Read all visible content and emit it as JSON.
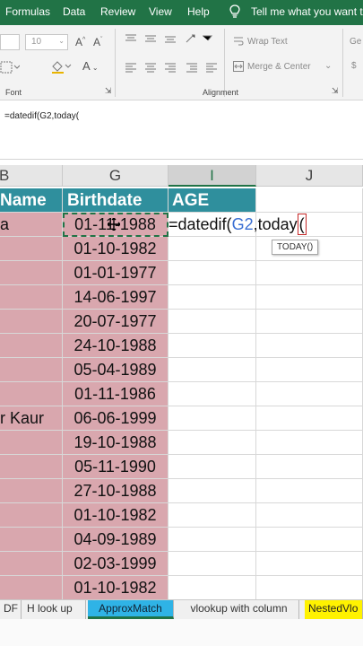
{
  "ribbon": {
    "tabs": [
      "Formulas",
      "Data",
      "Review",
      "View",
      "Help"
    ],
    "tell_me": "Tell me what you want to d",
    "font_size": "10",
    "wrap_text": "Wrap Text",
    "merge_center": "Merge & Center",
    "font_group_label": "Font",
    "alignment_group_label": "Alignment",
    "general_label": "Ge"
  },
  "formula_bar": {
    "text": "=datedif(G2,today("
  },
  "columns": {
    "b": "B",
    "g": "G",
    "i": "I",
    "j": "J"
  },
  "headers": {
    "name": "Name",
    "birthdate": "Birthdate",
    "age": "AGE"
  },
  "rows": [
    {
      "name": "a",
      "birthdate": "01-11-1988"
    },
    {
      "name": "",
      "birthdate": "01-10-1982"
    },
    {
      "name": "",
      "birthdate": "01-01-1977"
    },
    {
      "name": "",
      "birthdate": "14-06-1997"
    },
    {
      "name": "",
      "birthdate": "20-07-1977"
    },
    {
      "name": "",
      "birthdate": "24-10-1988"
    },
    {
      "name": "",
      "birthdate": "05-04-1989"
    },
    {
      "name": "",
      "birthdate": "01-11-1986"
    },
    {
      "name": "r Kaur",
      "birthdate": "06-06-1999"
    },
    {
      "name": "",
      "birthdate": "19-10-1988"
    },
    {
      "name": "",
      "birthdate": "05-11-1990"
    },
    {
      "name": "",
      "birthdate": "27-10-1988"
    },
    {
      "name": "",
      "birthdate": "01-10-1982"
    },
    {
      "name": "",
      "birthdate": "04-09-1989"
    },
    {
      "name": "",
      "birthdate": "02-03-1999"
    },
    {
      "name": "",
      "birthdate": "01-10-1982"
    }
  ],
  "editing": {
    "prefix": "=datedif(",
    "ref": "G2",
    "middle": ",today",
    "paren": "(",
    "tooltip": "TODAY()"
  },
  "sheets": [
    {
      "label": "DF",
      "state": "normal"
    },
    {
      "label": "H look up",
      "state": "normal"
    },
    {
      "label": "ApproxMatch",
      "state": "active"
    },
    {
      "label": "vlookup with column",
      "state": "normal"
    },
    {
      "label": "NestedVlo",
      "state": "highlight"
    }
  ],
  "colors": {
    "ribbon_green": "#217346",
    "header_teal": "#2f8f9d",
    "cell_pink": "#d9a7ae",
    "ref_blue": "#3a6fd3",
    "active_tab": "#2fb3e6",
    "highlight_tab": "#fff200"
  }
}
